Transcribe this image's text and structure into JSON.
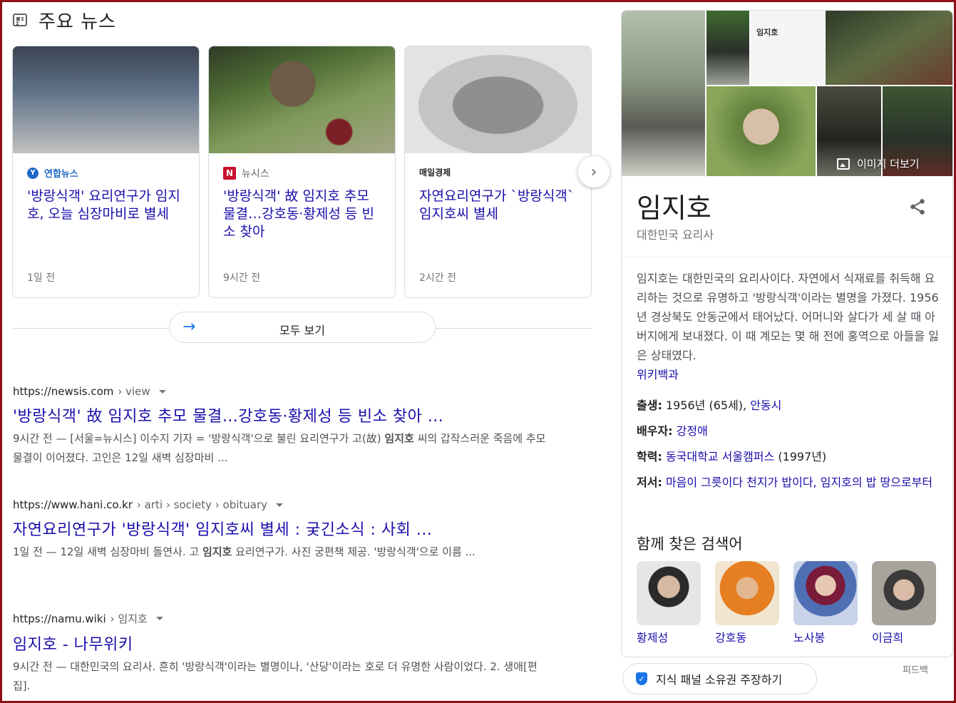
{
  "top_news": {
    "title": "주요 뉴스",
    "cards": [
      {
        "source": "연합뉴스",
        "headline": "'방랑식객' 요리연구가 임지호, 오늘 심장마비로 별세",
        "time": "1일 전"
      },
      {
        "source": "뉴시스",
        "headline": "'방랑식객' 故 임지호 추모 물결…강호동·황제성 등 빈소 찾아",
        "time": "9시간 전"
      },
      {
        "source": "매일경제",
        "headline": "자연요리연구가 `방랑식객` 임지호씨 별세",
        "time": "2시간 전"
      }
    ],
    "view_all": "모두 보기"
  },
  "results": [
    {
      "domain": "https://newsis.com",
      "path": "› view",
      "title": "'방랑식객' 故 임지호 추모 물결…강호동·황제성 등 빈소 찾아 ...",
      "snippet_pre": "9시간 전 — [서울=뉴시스] 이수지 기자 = '방랑식객'으로 불린 요리연구가 고(故) ",
      "snippet_bold": "임지호",
      "snippet_post": " 씨의 갑작스러운 죽음에 추모물결이 이어졌다. 고인은 12일 새벽 심장마비 ..."
    },
    {
      "domain": "https://www.hani.co.kr",
      "path": "› arti › society › obituary",
      "title": "자연요리연구가 '방랑식객' 임지호씨 별세 : 궂긴소식 : 사회 ...",
      "snippet_pre": "1일 전 — 12일 새벽 심장마비 돌연사. 고 ",
      "snippet_bold": "임지호",
      "snippet_post": " 요리연구가. 사진 궁편책 제공. '방랑식객'으로 이름 ..."
    },
    {
      "domain": "https://namu.wiki",
      "path": "› 임지호",
      "title": "임지호 - 나무위키",
      "snippet_pre": "9시간 전 — 대한민국의 요리사. 흔히 '방랑식객'이라는 별명이나, '산당'이라는 호로 더 유명한 사람이었다. 2. 생애[편집].",
      "snippet_bold": "",
      "snippet_post": ""
    }
  ],
  "knowledge_panel": {
    "more_images": "이미지 더보기",
    "image_card_name": "임지호",
    "name": "임지호",
    "subtitle": "대한민국 요리사",
    "description": "임지호는 대한민국의 요리사이다. 자연에서 식재료를 취득해 요리하는 것으로 유명하고 '방랑식객'이라는 별명을 가졌다. 1956년 경상북도 안동군에서 태어났다. 어머니와 살다가 세 살 때 아버지에게 보내졌다. 이 때 계모는 몇 해 전에 홍역으로 아들을 잃은 상태였다.",
    "wiki_link": "위키백과",
    "facts": {
      "born_label": "출생:",
      "born_value": "1956년 (65세), ",
      "born_link": "안동시",
      "spouse_label": "배우자:",
      "spouse_link": "강정애",
      "edu_label": "학력:",
      "edu_link": "동국대학교 서울캠퍼스",
      "edu_value": " (1997년)",
      "works_label": "저서:",
      "works_link": "마음이 그릇이다 천지가 밥이다, 임지호의 밥 땅으로부터"
    },
    "also_searched_title": "함께 찾은 검색어",
    "people": [
      "황제성",
      "강호동",
      "노사봉",
      "이금희"
    ]
  },
  "claim_button": "지식 패널 소유권 주장하기",
  "feedback": "피드백",
  "colors": {
    "link": "#1a0dab",
    "accent": "#1a73e8",
    "frame": "#8b0f17"
  }
}
